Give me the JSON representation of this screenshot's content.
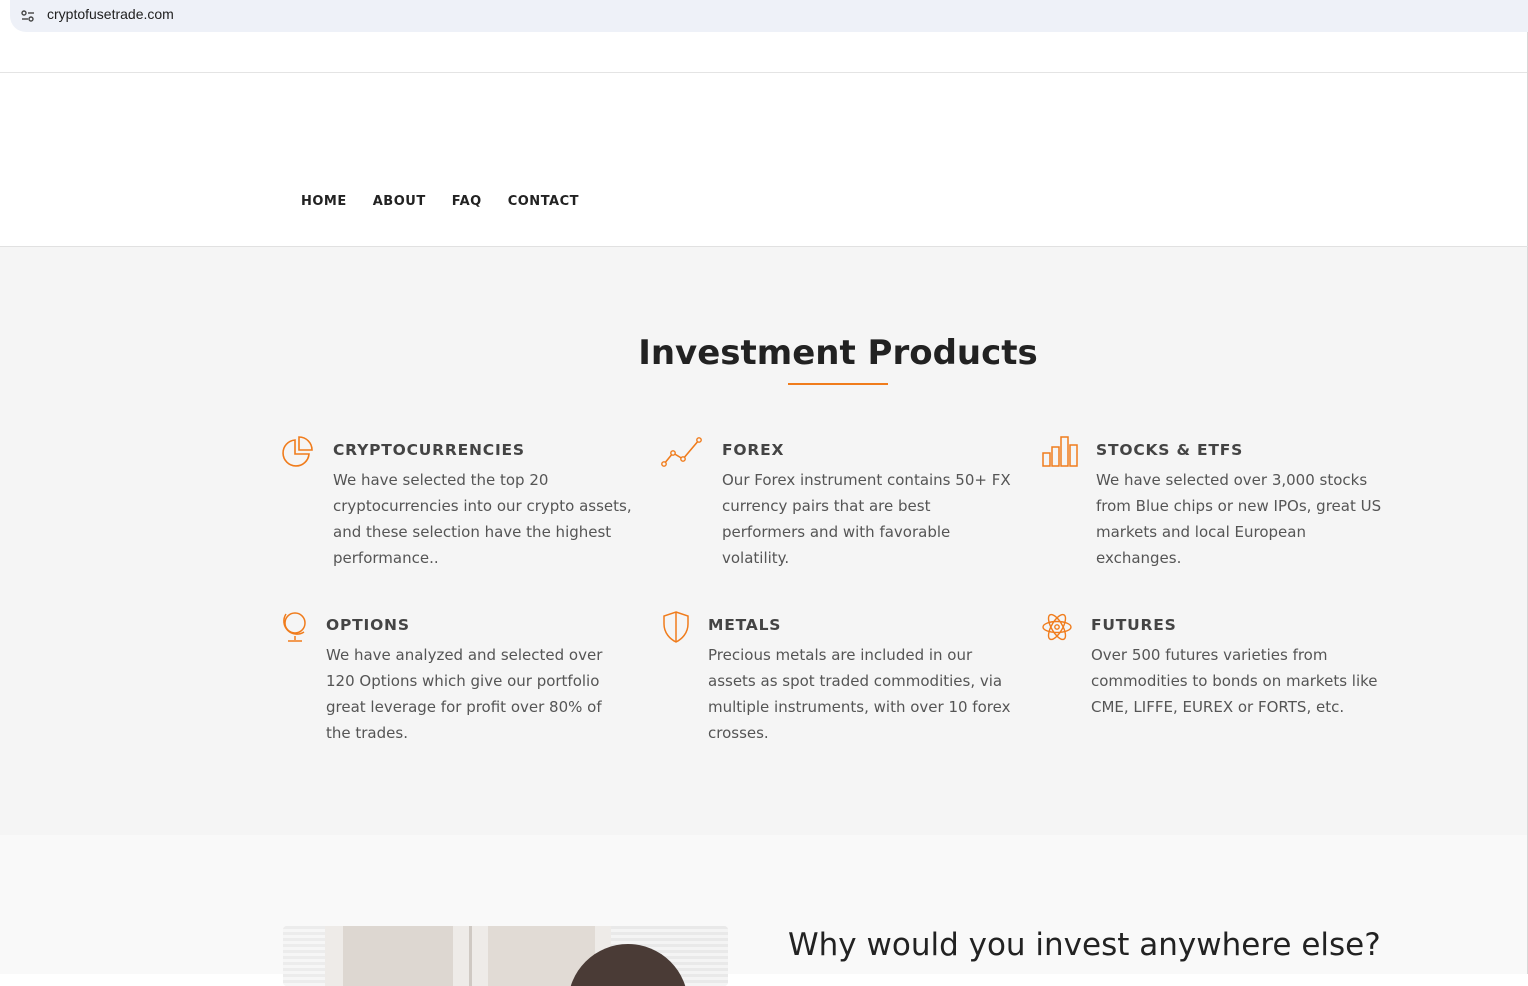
{
  "browser": {
    "url": "cryptofusetrade.com",
    "site_icon": "tune-icon"
  },
  "nav": {
    "items": [
      "HOME",
      "ABOUT",
      "FAQ",
      "CONTACT"
    ]
  },
  "products": {
    "title": "Investment Products",
    "accent_color": "#f07c1c",
    "items": [
      {
        "name": "CRYPTOCURRENCIES",
        "icon": "pie-chart-icon",
        "desc": [
          "We have selected the top 20",
          "cryptocurrencies into our crypto assets,",
          "and these selection have the highest",
          "performance.."
        ]
      },
      {
        "name": "FOREX",
        "icon": "line-chart-icon",
        "desc": [
          "Our Forex instrument contains 50+ FX",
          "currency pairs that are best",
          "performers and with favorable",
          "volatility."
        ]
      },
      {
        "name": "STOCKS & ETFS",
        "icon": "bar-chart-icon",
        "desc": [
          "We have selected over 3,000 stocks",
          "from Blue chips or new IPOs, great US",
          "markets and local European",
          "exchanges."
        ]
      },
      {
        "name": "OPTIONS",
        "icon": "globe-icon",
        "desc": [
          "We have analyzed and selected over",
          "120 Options which give our portfolio",
          "great leverage for profit over 80% of",
          "the trades."
        ]
      },
      {
        "name": "METALS",
        "icon": "shield-icon",
        "desc": [
          "Precious metals are included in our",
          "assets as spot traded commodities, via",
          "multiple instruments, with over 10 forex",
          "crosses."
        ]
      },
      {
        "name": "FUTURES",
        "icon": "atom-icon",
        "desc": [
          "Over 500 futures varieties from",
          "commodities to bonds on markets like",
          "CME, LIFFE, EUREX or FORTS, etc."
        ]
      }
    ]
  },
  "why": {
    "title": "Why would you invest anywhere else?"
  }
}
